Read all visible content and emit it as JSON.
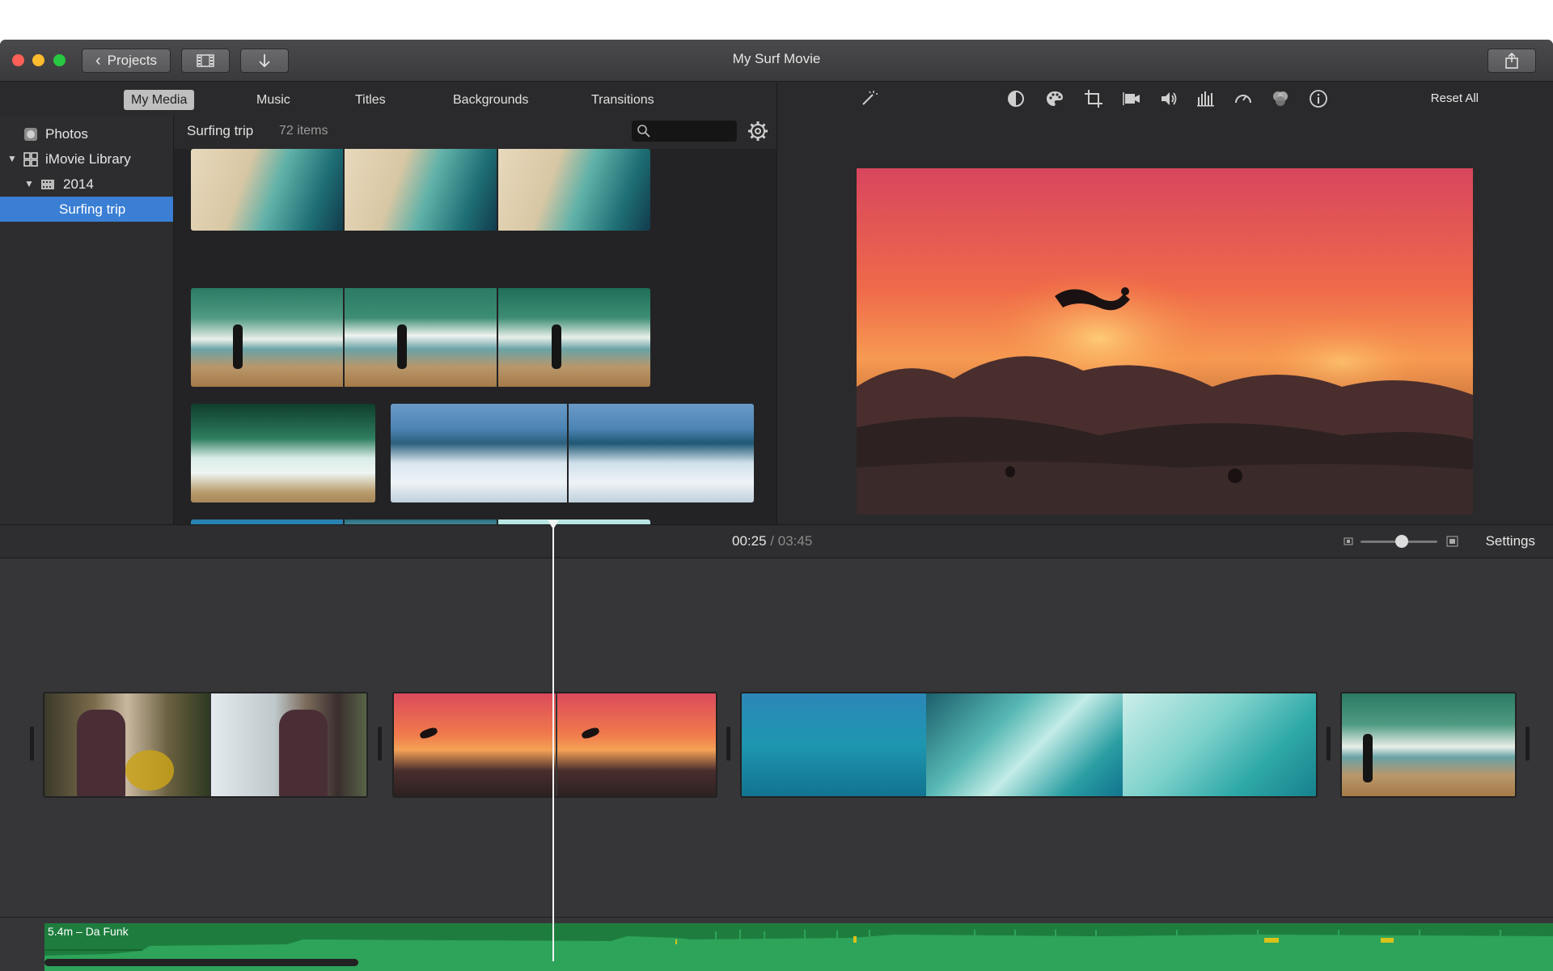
{
  "window": {
    "title": "My Surf Movie",
    "projects_label": "Projects"
  },
  "browser_tabs": [
    {
      "label": "My Media",
      "active": true
    },
    {
      "label": "Music",
      "active": false
    },
    {
      "label": "Titles",
      "active": false
    },
    {
      "label": "Backgrounds",
      "active": false
    },
    {
      "label": "Transitions",
      "active": false
    }
  ],
  "sidebar": {
    "items": [
      {
        "label": "Photos",
        "icon": "photos-icon"
      },
      {
        "label": "iMovie Library",
        "icon": "library-icon"
      },
      {
        "label": "2014",
        "icon": "film-icon"
      },
      {
        "label": "Surfing trip",
        "selected": true
      }
    ]
  },
  "browser": {
    "event_title": "Surfing trip",
    "item_count": "72 items",
    "search_placeholder": ""
  },
  "viewer": {
    "reset_label": "Reset All",
    "tools": [
      "magic-wand-icon",
      "color-balance-icon",
      "color-correction-icon",
      "crop-icon",
      "stabilization-icon",
      "volume-icon",
      "equalizer-icon",
      "speed-icon",
      "clip-filter-icon",
      "info-icon"
    ]
  },
  "timeline": {
    "current_time": "00:25",
    "separator": "/",
    "total_time": "03:45",
    "settings_label": "Settings",
    "audio_track_label": "5.4m – Da Funk"
  },
  "colors": {
    "accent": "#3a7fd4",
    "audio_green": "#1e7d3e",
    "audio_wave": "#2ea35a"
  }
}
